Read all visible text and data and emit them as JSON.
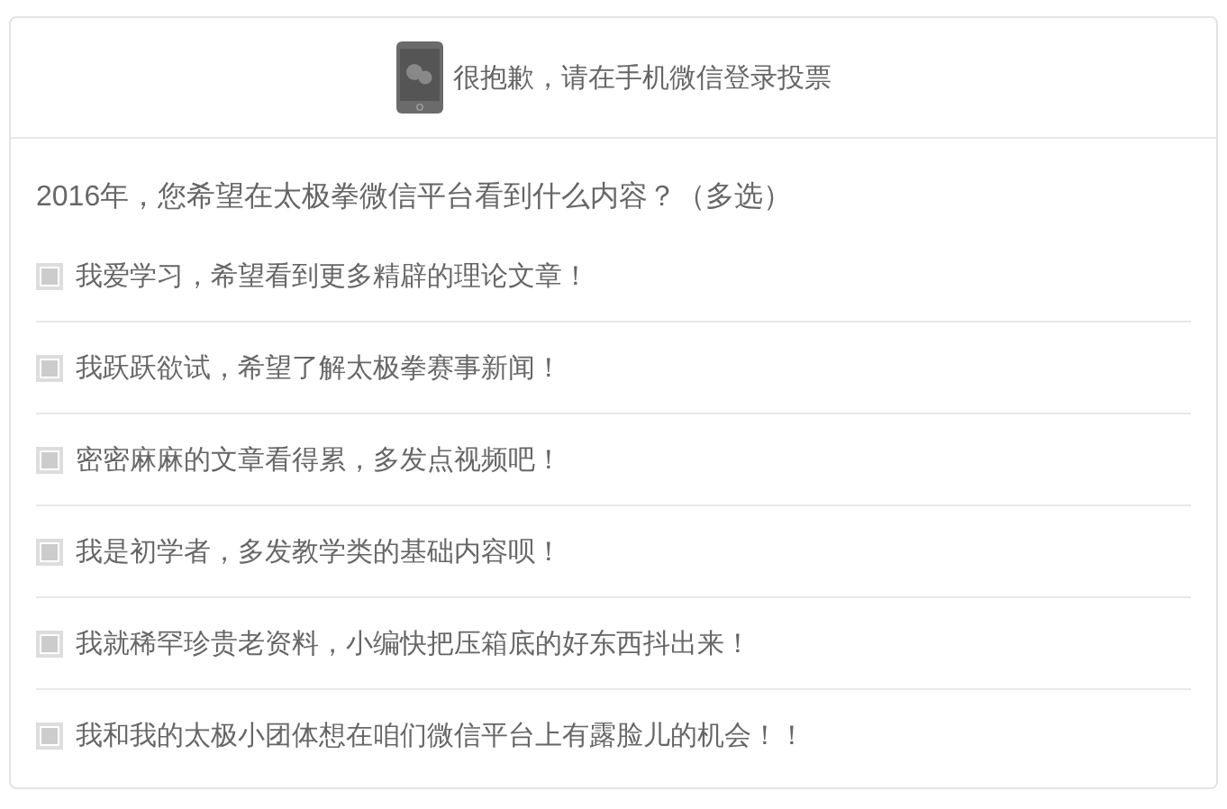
{
  "notice": {
    "text": "很抱歉，请在手机微信登录投票"
  },
  "question": "2016年，您希望在太极拳微信平台看到什么内容？（多选）",
  "options": [
    {
      "label": "我爱学习，希望看到更多精辟的理论文章！",
      "checked": false
    },
    {
      "label": "我跃跃欲试，希望了解太极拳赛事新闻！",
      "checked": false
    },
    {
      "label": "密密麻麻的文章看得累，多发点视频吧！",
      "checked": false
    },
    {
      "label": "我是初学者，多发教学类的基础内容呗！",
      "checked": false
    },
    {
      "label": "我就稀罕珍贵老资料，小编快把压箱底的好东西抖出来！",
      "checked": false
    },
    {
      "label": "我和我的太极小团体想在咱们微信平台上有露脸儿的机会！！",
      "checked": false
    }
  ]
}
